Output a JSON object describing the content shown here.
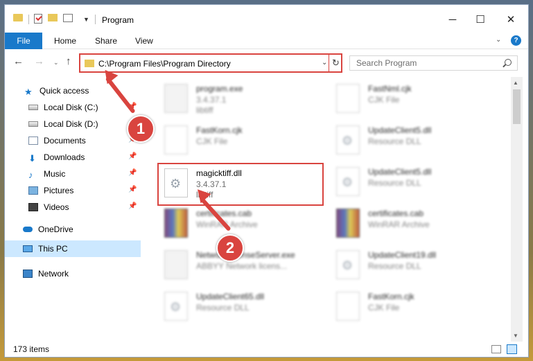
{
  "window": {
    "title": "Program",
    "min_glyph": "─",
    "max_glyph": "☐",
    "close_glyph": "✕"
  },
  "ribbon": {
    "tabs": [
      "File",
      "Home",
      "Share",
      "View"
    ],
    "help": "?"
  },
  "address": {
    "path": "C:\\Program Files\\Program Directory"
  },
  "search": {
    "placeholder": "Search Program"
  },
  "nav": {
    "items": [
      {
        "label": "Quick access",
        "icon": "star-icon"
      },
      {
        "label": "Local Disk (C:)",
        "icon": "disk-icon",
        "pinned": true
      },
      {
        "label": "Local Disk (D:)",
        "icon": "disk-icon"
      },
      {
        "label": "Documents",
        "icon": "documents-icon",
        "pinned": true
      },
      {
        "label": "Downloads",
        "icon": "download-icon",
        "pinned": true
      },
      {
        "label": "Music",
        "icon": "music-icon",
        "pinned": true
      },
      {
        "label": "Pictures",
        "icon": "pictures-icon",
        "pinned": true
      },
      {
        "label": "Videos",
        "icon": "videos-icon",
        "pinned": true
      },
      {
        "label": "OneDrive",
        "icon": "onedrive-icon"
      },
      {
        "label": "This PC",
        "icon": "pc-icon",
        "selected": true
      },
      {
        "label": "Network",
        "icon": "network-icon"
      }
    ]
  },
  "files": [
    {
      "name": "program.exe",
      "line2": "3.4.37.1",
      "line3": "libtiff"
    },
    {
      "name": "FastNml.cjk",
      "line2": "CJK File",
      "line3": ""
    },
    {
      "name": "FastKorn.cjk",
      "line2": "CJK File",
      "line3": ""
    },
    {
      "name": "UpdateClient5.dll",
      "line2": "Resource DLL",
      "line3": ""
    },
    {
      "name": "magicktiff.dll",
      "line2": "3.4.37.1",
      "line3": "libtiff"
    },
    {
      "name": "UpdateClient5.dll",
      "line2": "Resource DLL",
      "line3": ""
    },
    {
      "name": "certificates.cab",
      "line2": "WinRAR Archive",
      "line3": ""
    },
    {
      "name": "certificates.cab",
      "line2": "WinRAR Archive",
      "line3": ""
    },
    {
      "name": "NetworkLicenseServer.exe",
      "line2": "ABBYY Network licens...",
      "line3": ""
    },
    {
      "name": "UpdateClient19.dll",
      "line2": "Resource DLL",
      "line3": ""
    },
    {
      "name": "UpdateClient65.dll",
      "line2": "Resource DLL",
      "line3": ""
    },
    {
      "name": "FastKorn.cjk",
      "line2": "CJK File",
      "line3": ""
    }
  ],
  "status": {
    "count": "173 items"
  },
  "annotations": {
    "step1": "1",
    "step2": "2"
  },
  "colors": {
    "accent": "#1979ca",
    "highlight": "#d9443f",
    "selected_bg": "#cce8ff"
  }
}
